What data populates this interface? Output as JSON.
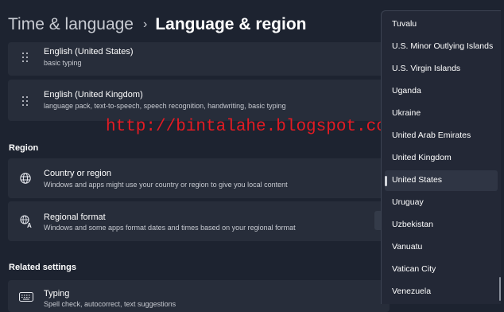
{
  "breadcrumb": {
    "parent": "Time & language",
    "separator": "›",
    "current": "Language & region"
  },
  "languages": [
    {
      "name": "English (United States)",
      "features": "basic typing"
    },
    {
      "name": "English (United Kingdom)",
      "features": "language pack, text-to-speech, speech recognition, handwriting, basic typing"
    }
  ],
  "region": {
    "heading": "Region",
    "country": {
      "title": "Country or region",
      "desc": "Windows and apps might use your country or region to give you local content"
    },
    "format": {
      "title": "Regional format",
      "desc": "Windows and some apps format dates and times based on your regional format"
    }
  },
  "related": {
    "heading": "Related settings",
    "typing": {
      "title": "Typing",
      "desc": "Spell check, autocorrect, text suggestions"
    }
  },
  "watermark": "http://bintalahe.blogspot.com/",
  "dropdown": {
    "items": [
      "Tuvalu",
      "U.S. Minor Outlying Islands",
      "U.S. Virgin Islands",
      "Uganda",
      "Ukraine",
      "United Arab Emirates",
      "United Kingdom",
      "United States",
      "Uruguay",
      "Uzbekistan",
      "Vanuatu",
      "Vatican City",
      "Venezuela"
    ],
    "selected": "United States"
  },
  "colors": {
    "background": "#1d2330",
    "card": "#272d3a",
    "dropdown": "#232836",
    "watermark": "#e31b23"
  },
  "icons": {
    "drag": "drag-handle-icon",
    "globe": "globe-icon",
    "format": "regional-format-icon",
    "keyboard": "keyboard-icon"
  }
}
